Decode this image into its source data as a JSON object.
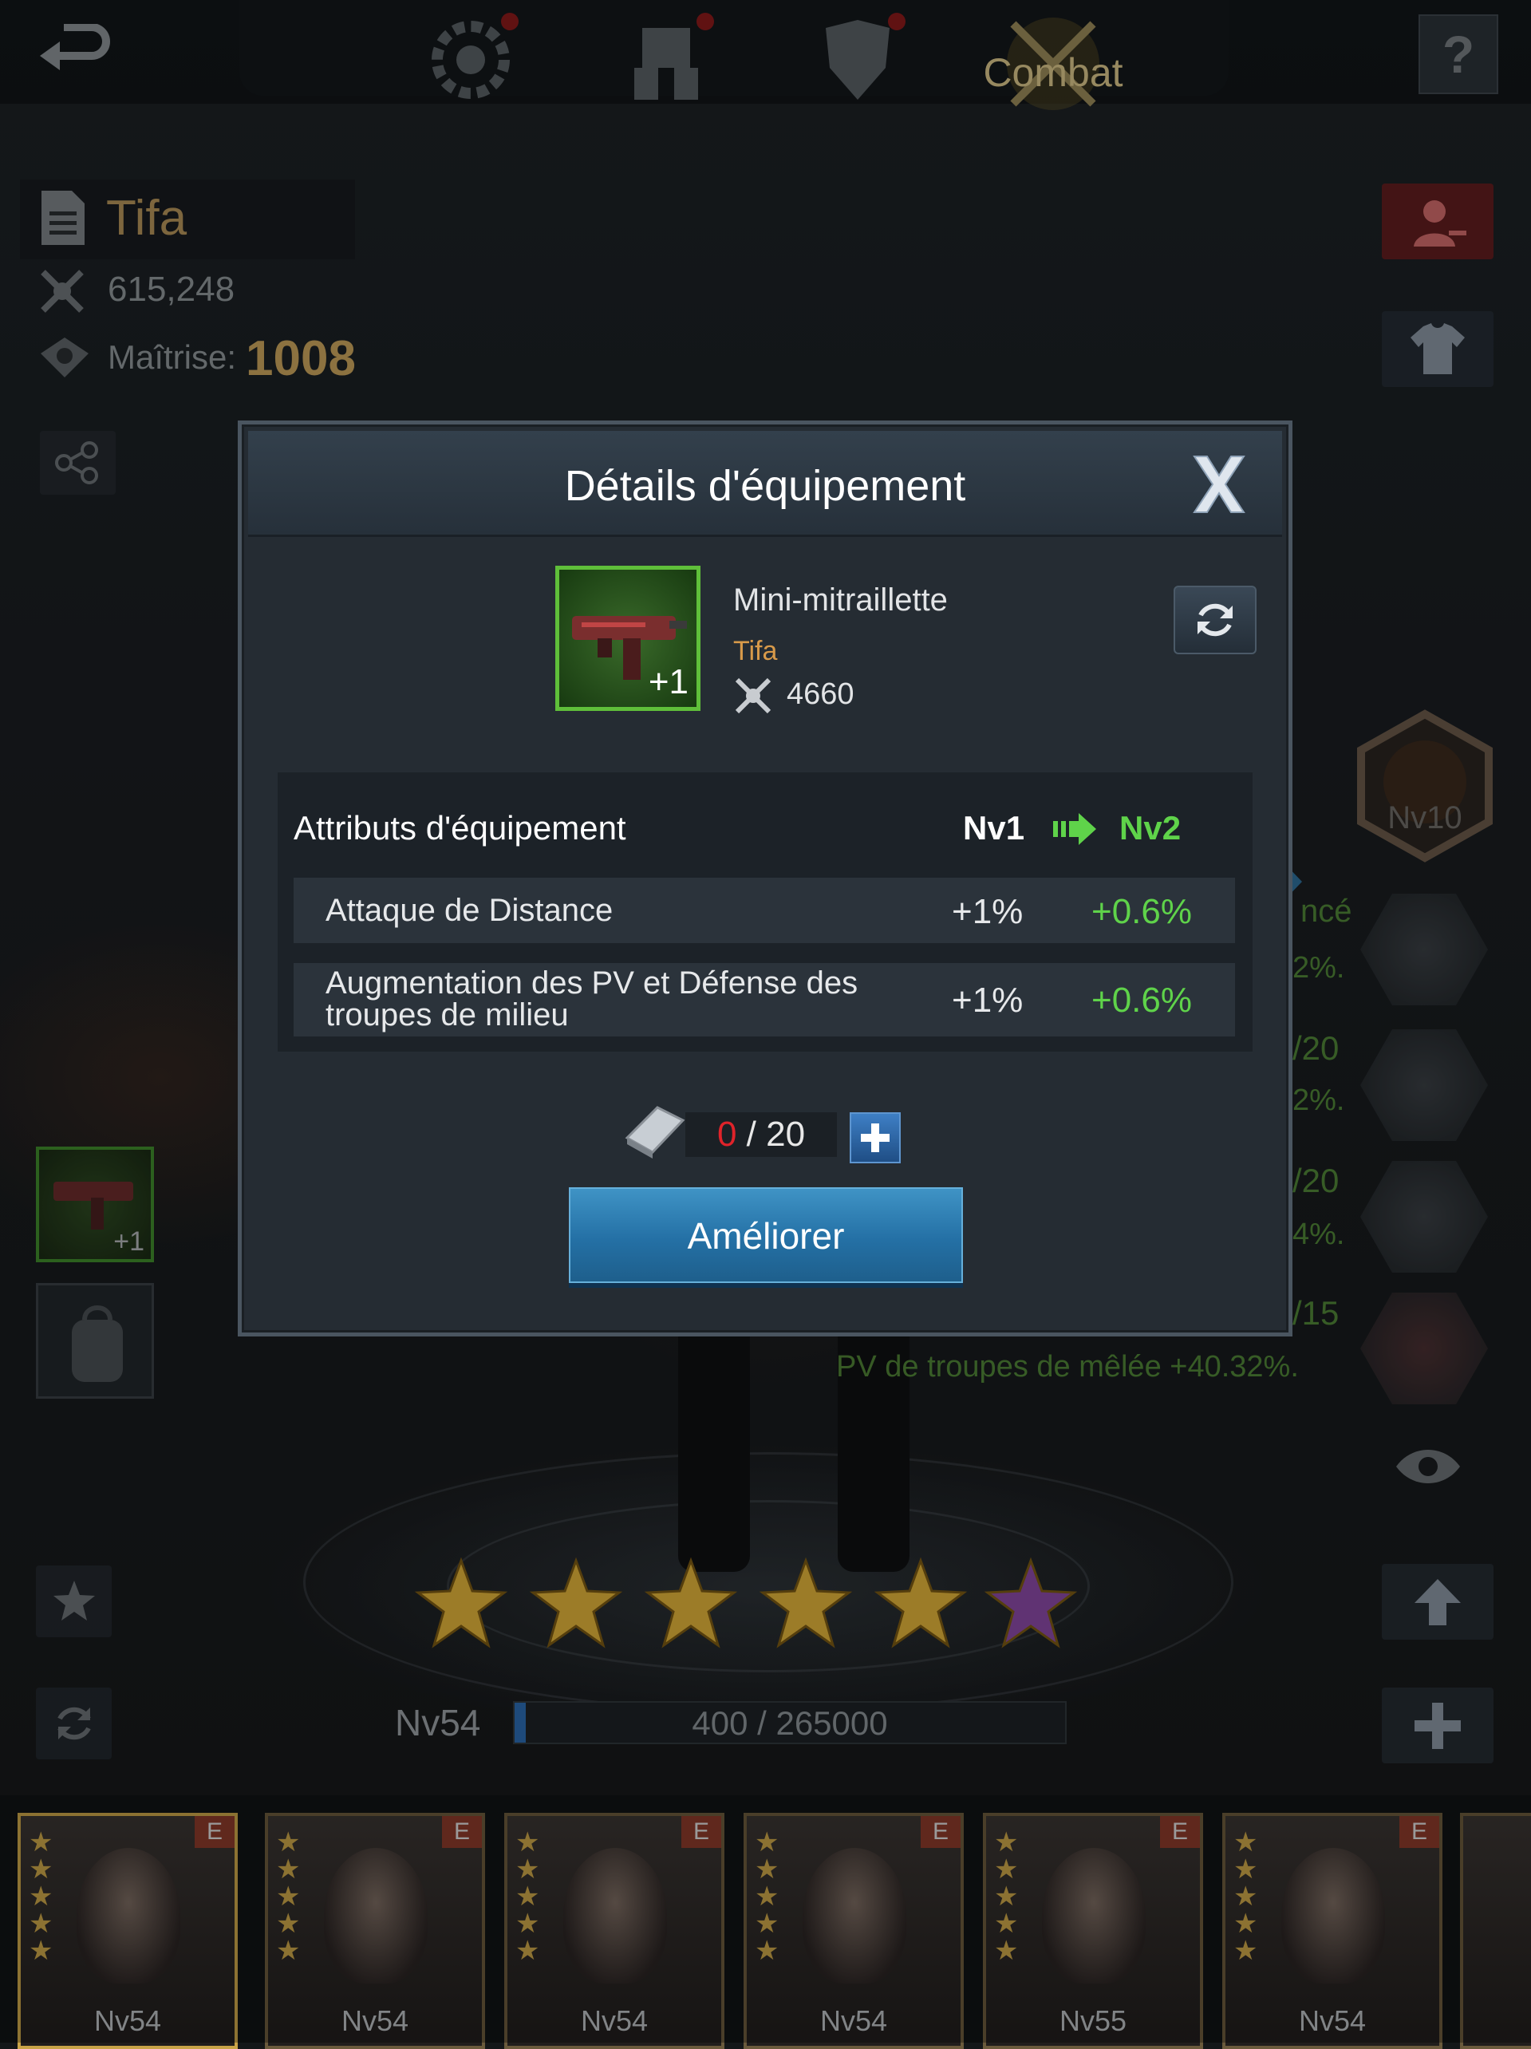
{
  "topbar": {
    "back_icon": "back-arrow-icon",
    "tabs": [
      {
        "icon": "gear-cog-icon",
        "has_alert": true
      },
      {
        "icon": "mech-icon",
        "has_alert": true
      },
      {
        "icon": "armor-icon",
        "has_alert": true
      },
      {
        "icon": "crossed-swords-icon",
        "label": "Combat",
        "active": true
      }
    ],
    "help_label": "?"
  },
  "hero": {
    "name": "Tifa",
    "power": "615,248",
    "mastery_label": "Maîtrise:",
    "mastery_value": "1008",
    "level": "Nv54",
    "xp_text": "400 / 265000",
    "xp_fraction": 0.0015,
    "stars_full": 5,
    "stars_partial": 1
  },
  "right_panel": {
    "badge_level": "Nv10",
    "bg_texts": [
      "ncé",
      "2%.",
      "/20",
      "2%.",
      "/20",
      "4%.",
      "/15"
    ],
    "bg_bonus": "PV de troupes de mêlée +40.32%."
  },
  "left_slots": {
    "weapon_plus": "+1"
  },
  "dialog": {
    "title": "Détails d'équipement",
    "item_name": "Mini-mitraillette",
    "item_owner": "Tifa",
    "item_power": "4660",
    "item_plus": "+1",
    "attr_header": "Attributs d'équipement",
    "level_from": "Nv1",
    "level_to": "Nv2",
    "attributes": [
      {
        "name": "Attaque de Distance",
        "current": "+1%",
        "next": "+0.6%"
      },
      {
        "name_line1": "Augmentation des PV et Défense des",
        "name_line2": "troupes de milieu",
        "current": "+1%",
        "next": "+0.6%"
      }
    ],
    "material_have": "0",
    "material_need": "/ 20",
    "upgrade_label": "Améliorer"
  },
  "portraits": [
    {
      "level": "Nv54",
      "grade": "E",
      "selected": true
    },
    {
      "level": "Nv54",
      "grade": "E"
    },
    {
      "level": "Nv54",
      "grade": "E"
    },
    {
      "level": "Nv54",
      "grade": "E"
    },
    {
      "level": "Nv55",
      "grade": "E"
    },
    {
      "level": "Nv54",
      "grade": "E"
    }
  ],
  "colors": {
    "accent_green": "#5fd34a",
    "owner_orange": "#d89a4a",
    "material_red": "#e0232a",
    "button_blue": "#2470a5",
    "mastery_gold": "#c9a45c"
  }
}
